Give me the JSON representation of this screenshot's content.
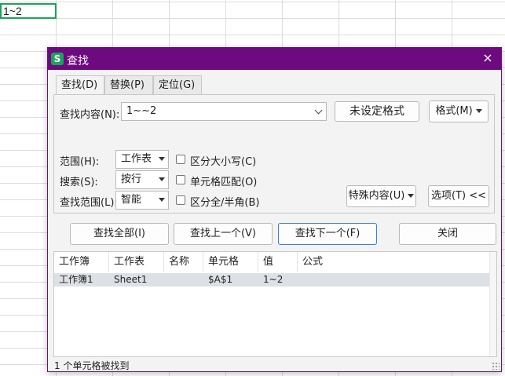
{
  "sheet": {
    "active_cell_text": "1~2"
  },
  "dialog": {
    "title": "查找",
    "close_icon": "×",
    "tabs": [
      {
        "label": "查找(D)",
        "active": true
      },
      {
        "label": "替换(P)",
        "active": false
      },
      {
        "label": "定位(G)",
        "active": false
      }
    ],
    "find_label": "查找内容(N):",
    "find_value": "1~~2",
    "format_status": "未设定格式",
    "format_button": "格式(M)",
    "scope_label": "范围(H):",
    "scope_value": "工作表",
    "search_label": "搜索(S):",
    "search_value": "按行",
    "lookin_label": "查找范围(L):",
    "lookin_value": "智能",
    "opt_case": "区分大小写(C)",
    "opt_cell": "单元格匹配(O)",
    "opt_width": "区分全/半角(B)",
    "special_button": "特殊内容(U)",
    "options_button": "选项(T) <<",
    "find_all": "查找全部(I)",
    "find_prev": "查找上一个(V)",
    "find_next": "查找下一个(F)",
    "close_button": "关闭",
    "results": {
      "headers": [
        "工作簿",
        "工作表",
        "名称",
        "单元格",
        "值",
        "公式"
      ],
      "rows": [
        {
          "workbook": "工作簿1",
          "sheet": "Sheet1",
          "name": "",
          "cell": "$A$1",
          "value": "1~2",
          "formula": ""
        }
      ]
    },
    "status": "1 个单元格被找到"
  }
}
